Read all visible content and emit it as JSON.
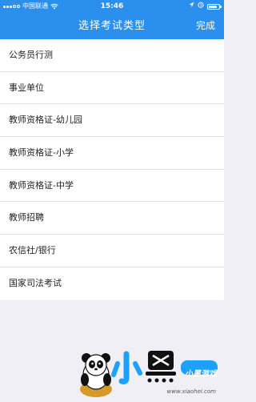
{
  "status_bar": {
    "carrier": "中国联通",
    "time": "15:46",
    "battery_level": 0.85
  },
  "nav": {
    "title": "选择考试类型",
    "done_label": "完成"
  },
  "exam_types": [
    "公务员行测",
    "事业单位",
    "教师资格证-幼儿园",
    "教师资格证-小学",
    "教师资格证-中学",
    "教师招聘",
    "农信社/银行",
    "国家司法考试"
  ],
  "watermark": {
    "logo_text": "小黑游戏",
    "url": "www.xiaohei.com"
  },
  "colors": {
    "accent": "#2b8fee",
    "background": "#f0eff5"
  }
}
